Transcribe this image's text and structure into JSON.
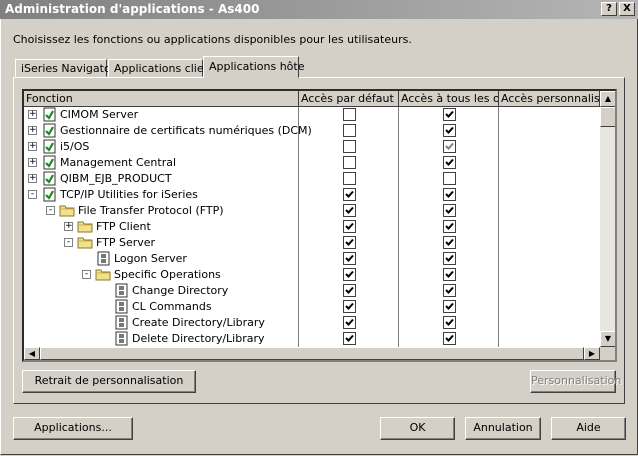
{
  "window": {
    "title": "Administration d'applications - As400",
    "help_btn": "?",
    "close_btn": "X"
  },
  "instructions": "Choisissez les fonctions ou applications disponibles pour les utilisateurs.",
  "tabs": [
    {
      "label": "iSeries Navigator"
    },
    {
      "label": "Applications client"
    },
    {
      "label": "Applications hôte"
    }
  ],
  "table": {
    "columns": [
      {
        "label": "Fonction"
      },
      {
        "label": "Accès par défaut"
      },
      {
        "label": "Accès à tous les obj"
      },
      {
        "label": "Accès personnalisé"
      }
    ],
    "rows": [
      {
        "label": "CIMOM Server",
        "level": 0,
        "expander": "+",
        "icon": "function-icon",
        "default": false,
        "all": true
      },
      {
        "label": "Gestionnaire de certificats numériques (DCM)",
        "level": 0,
        "expander": "+",
        "icon": "function-icon",
        "default": false,
        "all": true
      },
      {
        "label": "i5/OS",
        "level": 0,
        "expander": "+",
        "icon": "function-icon",
        "default": false,
        "all": true,
        "all_disabled": true
      },
      {
        "label": "Management Central",
        "level": 0,
        "expander": "+",
        "icon": "function-icon",
        "default": false,
        "all": true
      },
      {
        "label": "QIBM_EJB_PRODUCT",
        "level": 0,
        "expander": "+",
        "icon": "function-icon",
        "default": false,
        "all": false
      },
      {
        "label": "TCP/IP Utilities for iSeries",
        "level": 0,
        "expander": "-",
        "icon": "function-icon",
        "default": true,
        "all": true
      },
      {
        "label": "File Transfer Protocol (FTP)",
        "level": 1,
        "expander": "-",
        "icon": "folder-icon",
        "default": true,
        "all": true
      },
      {
        "label": "FTP Client",
        "level": 2,
        "expander": "+",
        "icon": "folder-icon",
        "default": true,
        "all": true
      },
      {
        "label": "FTP Server",
        "level": 2,
        "expander": "-",
        "icon": "folder-icon",
        "default": true,
        "all": true
      },
      {
        "label": "Logon Server",
        "level": 3,
        "expander": "",
        "icon": "server-icon",
        "default": true,
        "all": true
      },
      {
        "label": "Specific Operations",
        "level": 3,
        "expander": "-",
        "icon": "folder-icon",
        "default": true,
        "all": true
      },
      {
        "label": "Change Directory",
        "level": 4,
        "expander": "",
        "icon": "server-icon",
        "default": true,
        "all": true
      },
      {
        "label": "CL Commands",
        "level": 4,
        "expander": "",
        "icon": "server-icon",
        "default": true,
        "all": true
      },
      {
        "label": "Create Directory/Library",
        "level": 4,
        "expander": "",
        "icon": "server-icon",
        "default": true,
        "all": true
      },
      {
        "label": "Delete Directory/Library",
        "level": 4,
        "expander": "",
        "icon": "server-icon",
        "default": true,
        "all": true
      }
    ]
  },
  "buttons": {
    "remove_customization": "Retrait de personnalisation",
    "customize": "Personnalisation",
    "applications": "Applications...",
    "ok": "OK",
    "cancel": "Annulation",
    "help": "Aide"
  }
}
